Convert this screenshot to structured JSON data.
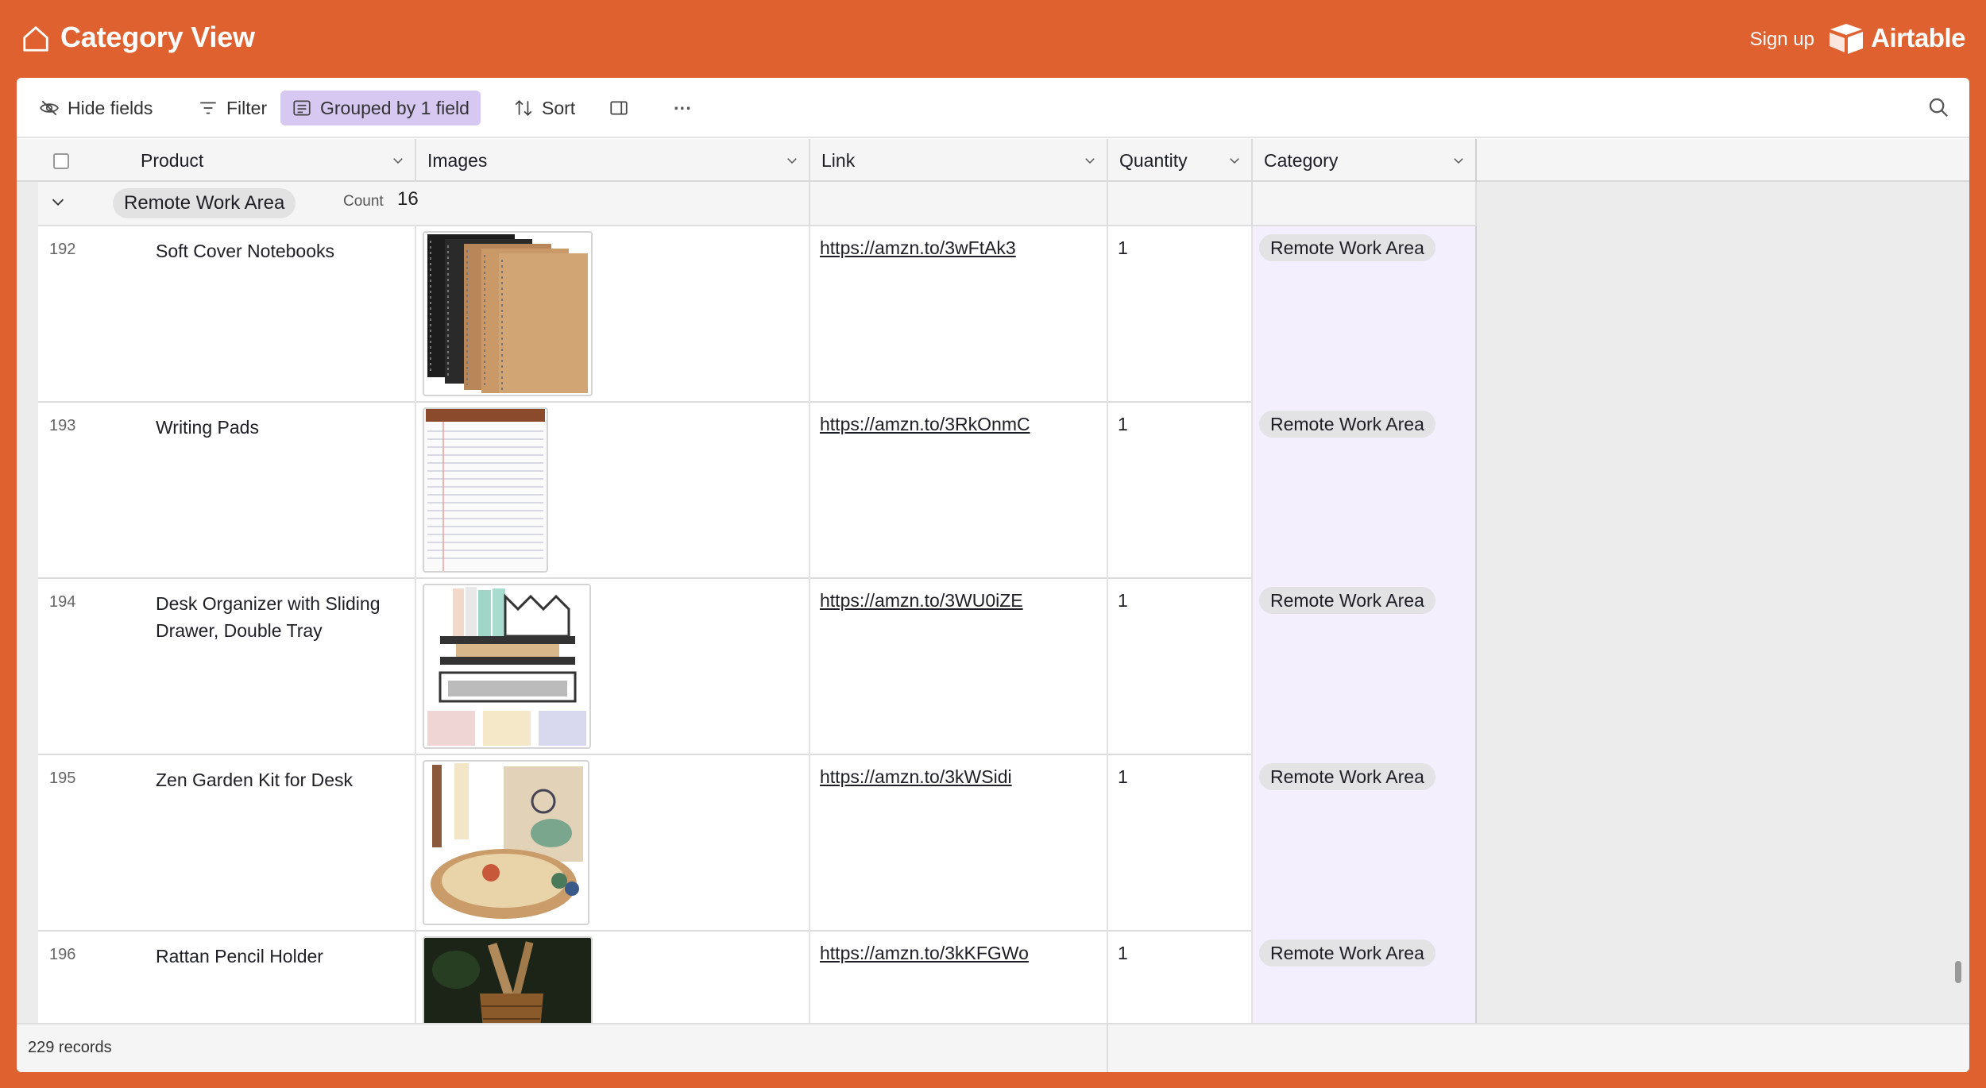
{
  "app": {
    "title": "Category View",
    "sign_up": "Sign up",
    "brand": "Airtable"
  },
  "toolbar": {
    "hide_fields": "Hide fields",
    "filter": "Filter",
    "grouped": "Grouped by 1 field",
    "sort": "Sort",
    "more": "···"
  },
  "columns": [
    "Product",
    "Images",
    "Link",
    "Quantity",
    "Category"
  ],
  "group": {
    "name": "Remote Work Area",
    "count_label": "Count",
    "count": "16"
  },
  "rows": [
    {
      "num": "192",
      "product": "Soft Cover Notebooks",
      "image": "spiral-notebooks",
      "link": "https://amzn.to/3wFtAk3",
      "quantity": "1",
      "category": "Remote Work Area"
    },
    {
      "num": "193",
      "product": "Writing Pads",
      "image": "legal-pad",
      "link": "https://amzn.to/3RkOnmC",
      "quantity": "1",
      "category": "Remote Work Area"
    },
    {
      "num": "194",
      "product": "Desk Organizer with Sliding Drawer, Double Tray",
      "image": "desk-organizer",
      "link": "https://amzn.to/3WU0iZE",
      "quantity": "1",
      "category": "Remote Work Area"
    },
    {
      "num": "195",
      "product": "Zen Garden Kit for Desk",
      "image": "zen-garden",
      "link": "https://amzn.to/3kWSidi",
      "quantity": "1",
      "category": "Remote Work Area"
    },
    {
      "num": "196",
      "product": "Rattan Pencil Holder",
      "image": "pencil-holder",
      "link": "https://amzn.to/3kKFGWo",
      "quantity": "1",
      "category": "Remote Work Area"
    }
  ],
  "footer": {
    "records": "229 records"
  },
  "colors": {
    "brand_orange": "#e06130",
    "grouped_bg": "#d7c8f2",
    "category_col_bg": "#f3effd"
  }
}
